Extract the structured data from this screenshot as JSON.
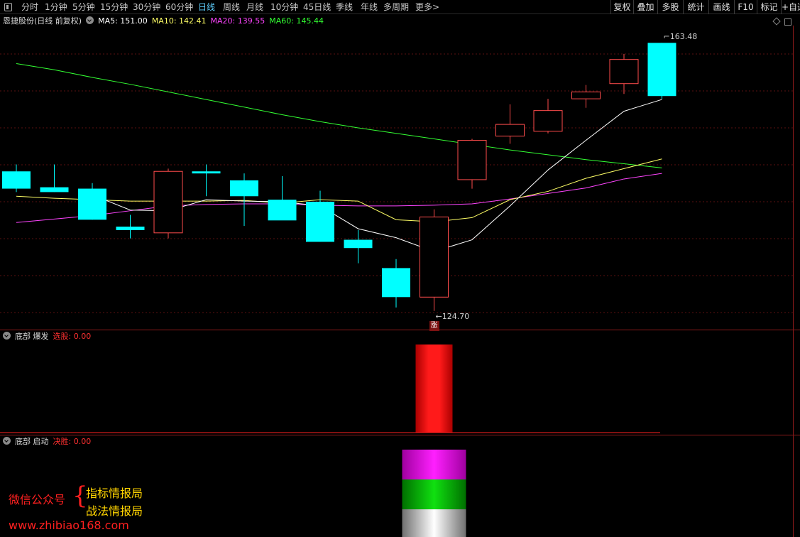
{
  "toolbar": {
    "periods": [
      "分时",
      "1分钟",
      "5分钟",
      "15分钟",
      "30分钟",
      "60分钟",
      "日线",
      "周线",
      "月线",
      "10分钟",
      "45日线",
      "季线",
      "年线",
      "多周期",
      "更多>"
    ],
    "active_period": "日线",
    "tools": [
      "复权",
      "叠加",
      "多股",
      "统计",
      "画线",
      "F10",
      "标记",
      "+自选"
    ]
  },
  "main_panel": {
    "title": "恩捷股份(日线 前复权)",
    "ma5": "MA5: 151.00",
    "ma10": "MA10: 142.41",
    "ma20": "MA20: 139.55",
    "ma60": "MA60: 145.44",
    "high_label": "163.48",
    "low_label": "124.70",
    "rise_mark": "涨",
    "colors": {
      "ma5": "#ffffff",
      "ma10": "#ffff66",
      "ma20": "#ff44ff",
      "ma60": "#33ff33",
      "up": "#ff4c4c",
      "down": "#00ffff"
    }
  },
  "panel2": {
    "name": "底部 爆发",
    "param": "选股: 0.00"
  },
  "panel3": {
    "name": "底部 启动",
    "param": "决胜: 0.00"
  },
  "watermark": {
    "account": "微信公众号",
    "brace": "{",
    "line1": "指标情报局",
    "line2": "战法情报局",
    "url": "www.zhibiao168.com"
  },
  "chart_data": {
    "type": "candlestick",
    "candles": [
      {
        "o": 144.9,
        "h": 145.9,
        "l": 141.9,
        "c": 142.4
      },
      {
        "o": 142.6,
        "h": 145.9,
        "l": 141.9,
        "c": 141.9
      },
      {
        "o": 142.4,
        "h": 143.2,
        "l": 137.9,
        "c": 137.9
      },
      {
        "o": 136.9,
        "h": 138.6,
        "l": 135.2,
        "c": 136.4
      },
      {
        "o": 136.0,
        "h": 145.3,
        "l": 135.2,
        "c": 144.9
      },
      {
        "o": 144.9,
        "h": 145.9,
        "l": 141.3,
        "c": 144.6
      },
      {
        "o": 143.6,
        "h": 144.6,
        "l": 137.0,
        "c": 141.3
      },
      {
        "o": 140.8,
        "h": 144.2,
        "l": 138.7,
        "c": 137.8
      },
      {
        "o": 140.5,
        "h": 142.1,
        "l": 134.7,
        "c": 134.7
      },
      {
        "o": 135.0,
        "h": 136.4,
        "l": 131.6,
        "c": 133.8
      },
      {
        "o": 130.9,
        "h": 132.2,
        "l": 125.2,
        "c": 126.7
      },
      {
        "o": 126.7,
        "h": 139.4,
        "l": 124.7,
        "c": 138.3
      },
      {
        "o": 143.7,
        "h": 149.6,
        "l": 142.4,
        "c": 149.4
      },
      {
        "o": 150.0,
        "h": 154.6,
        "l": 148.9,
        "c": 151.7
      },
      {
        "o": 150.7,
        "h": 155.4,
        "l": 150.4,
        "c": 153.7
      },
      {
        "o": 155.4,
        "h": 157.4,
        "l": 154.1,
        "c": 156.4
      },
      {
        "o": 157.6,
        "h": 161.9,
        "l": 156.1,
        "c": 161.1
      },
      {
        "o": 163.5,
        "h": 163.5,
        "l": 155.4,
        "c": 155.8
      }
    ],
    "ma5": [
      141.5,
      139.3,
      139.2,
      140.8,
      140.6,
      140.5,
      139.9,
      136.6,
      135.3,
      133.3,
      135.0,
      139.9,
      145.1,
      149.4,
      153.6,
      155.3
    ],
    "ma10": [
      141.3,
      141.0,
      140.8,
      140.6,
      140.6,
      140.6,
      140.7,
      140.3,
      140.8,
      140.6,
      137.9,
      137.6,
      138.2,
      140.8,
      142.0,
      143.9,
      145.3,
      146.7
    ],
    "ma20": [
      137.5,
      138.0,
      138.5,
      139.2,
      139.9,
      140.1,
      140.2,
      140.2,
      140.0,
      139.9,
      139.9,
      140.0,
      140.2,
      140.9,
      141.7,
      142.5,
      143.8,
      144.6
    ],
    "ma60": [
      160.5,
      159.6,
      158.5,
      157.5,
      156.4,
      155.3,
      154.2,
      153.1,
      152.1,
      151.2,
      150.4,
      149.6,
      148.8,
      148.0,
      147.3,
      146.6,
      146.0,
      145.4
    ],
    "ylim": [
      122,
      166
    ],
    "signal1_index": 11,
    "signal2_index": 11
  }
}
